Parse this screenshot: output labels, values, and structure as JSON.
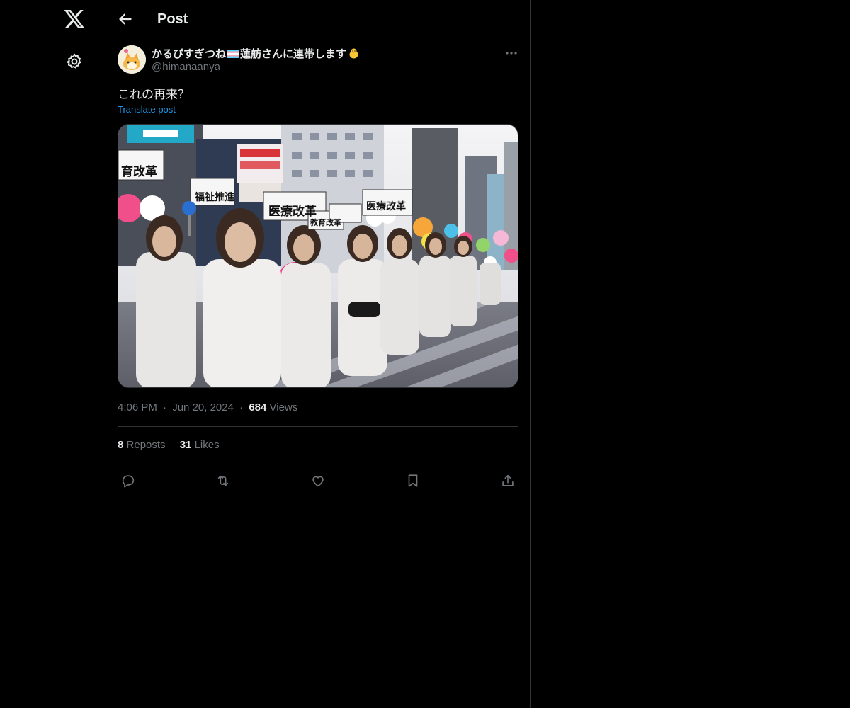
{
  "nav": {
    "logo_icon": "x-logo-icon",
    "settings_icon": "gear-icon"
  },
  "header": {
    "title": "Post",
    "back_icon": "arrow-left-icon"
  },
  "post": {
    "author": {
      "display_name_part1": "かるぴすぎつね",
      "display_name_part2": "蓮舫さんに連帯します",
      "handle": "@himanaanya"
    },
    "text": "これの再来？",
    "translate_label": "Translate post",
    "time": "4:06 PM",
    "date": "Jun 20, 2024",
    "dot": "·",
    "views_count": "684",
    "views_label": "Views",
    "reposts_count": "8",
    "reposts_label": "Reposts",
    "likes_count": "31",
    "likes_label": "Likes",
    "media_signs": [
      "医療改革",
      "福祉推進",
      "医療改革",
      "教育改革",
      "育改革"
    ]
  },
  "colors": {
    "accent": "#1d9bf0",
    "muted": "#71767b",
    "text": "#e7e9ea",
    "border": "#2f3336"
  }
}
